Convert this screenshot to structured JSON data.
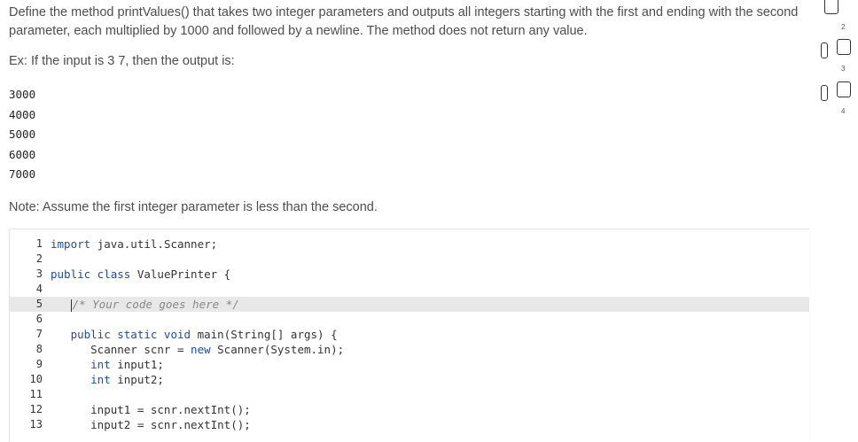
{
  "question": {
    "prompt": "Define the method printValues() that takes two integer parameters and outputs all integers starting with the first and ending with the second parameter, each multiplied by 1000 and followed by a newline. The method does not return any value.",
    "example_intro": "Ex: If the input is 3 7, then the output is:",
    "output_lines": [
      "3000",
      "4000",
      "5000",
      "6000",
      "7000"
    ],
    "note": "Note: Assume the first integer parameter is less than the second."
  },
  "editor": {
    "lines": [
      {
        "n": "1",
        "text": "import java.util.Scanner;"
      },
      {
        "n": "2",
        "text": ""
      },
      {
        "n": "3",
        "text": "public class ValuePrinter {"
      },
      {
        "n": "4",
        "text": ""
      },
      {
        "n": "5",
        "text": "   /* Your code goes here */"
      },
      {
        "n": "6",
        "text": ""
      },
      {
        "n": "7",
        "text": "   public static void main(String[] args) {"
      },
      {
        "n": "8",
        "text": "      Scanner scnr = new Scanner(System.in);"
      },
      {
        "n": "9",
        "text": "      int input1;"
      },
      {
        "n": "10",
        "text": "      int input2;"
      },
      {
        "n": "11",
        "text": ""
      },
      {
        "n": "12",
        "text": "      input1 = scnr.nextInt();"
      },
      {
        "n": "13",
        "text": "      input2 = scnr.nextInt();"
      }
    ]
  },
  "sidebar": {
    "items": [
      "2",
      "3",
      "4"
    ]
  }
}
